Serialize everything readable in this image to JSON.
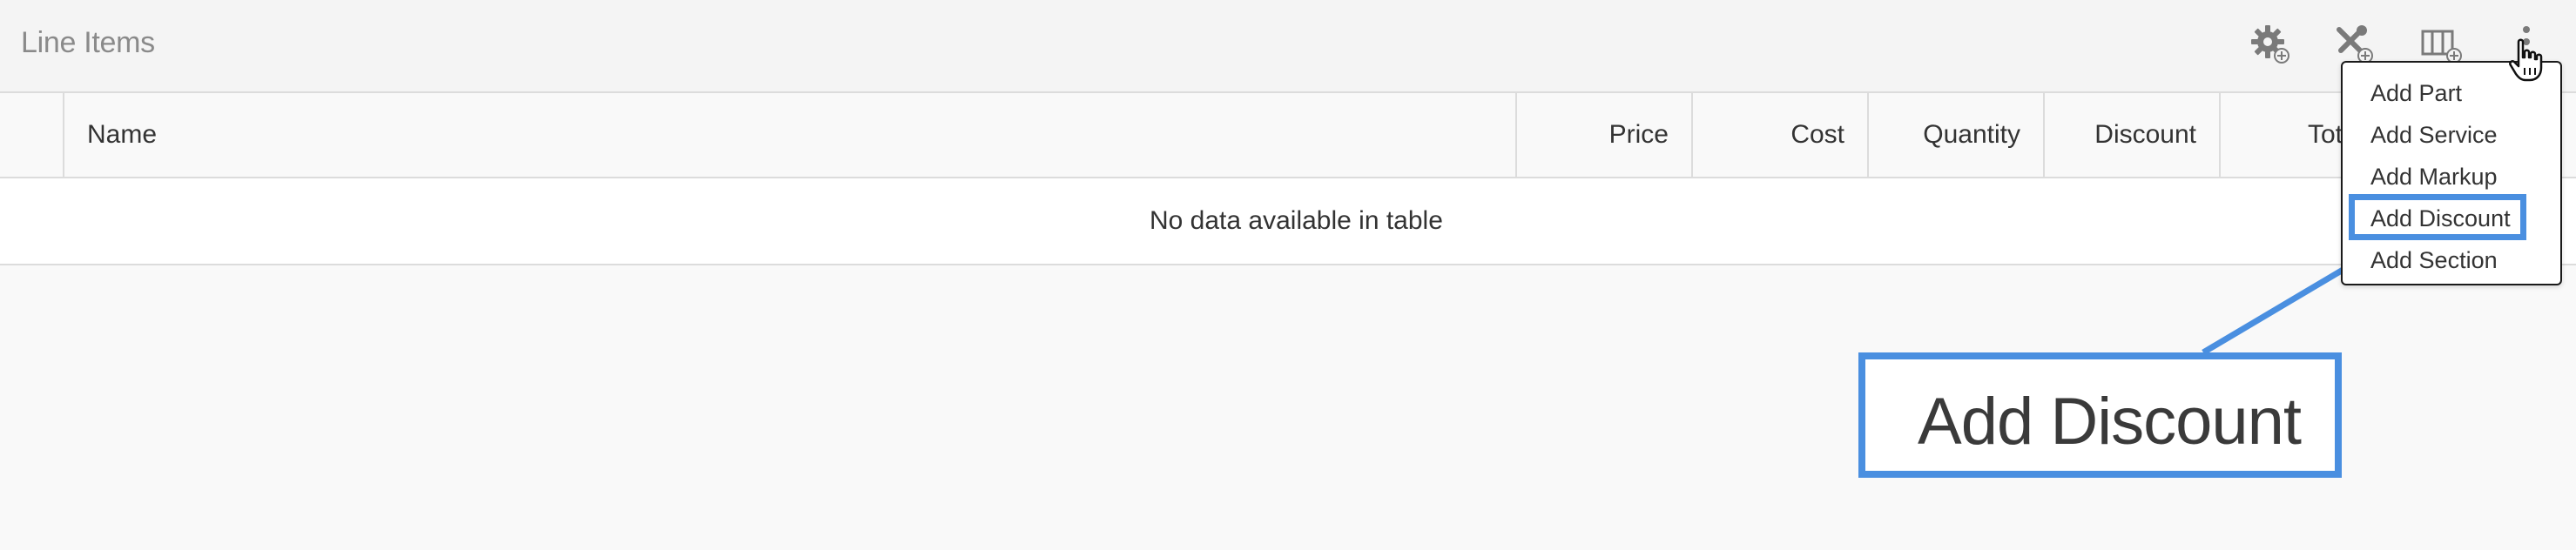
{
  "header": {
    "title": "Line Items",
    "tools": [
      {
        "name": "settings-add-icon"
      },
      {
        "name": "tools-add-icon"
      },
      {
        "name": "columns-add-icon"
      },
      {
        "name": "more-vertical-icon"
      }
    ]
  },
  "table": {
    "columns": [
      "",
      "Name",
      "Price",
      "Cost",
      "Quantity",
      "Discount",
      "Tot"
    ],
    "empty_message": "No data available in table"
  },
  "menu": {
    "items": [
      "Add Part",
      "Add Service",
      "Add Markup",
      "Add Discount",
      "Add Section"
    ],
    "highlighted": "Add Discount"
  },
  "callout": {
    "text": "Add Discount"
  },
  "colors": {
    "highlight": "#4a8fe0",
    "icon": "#7a7a7a"
  }
}
